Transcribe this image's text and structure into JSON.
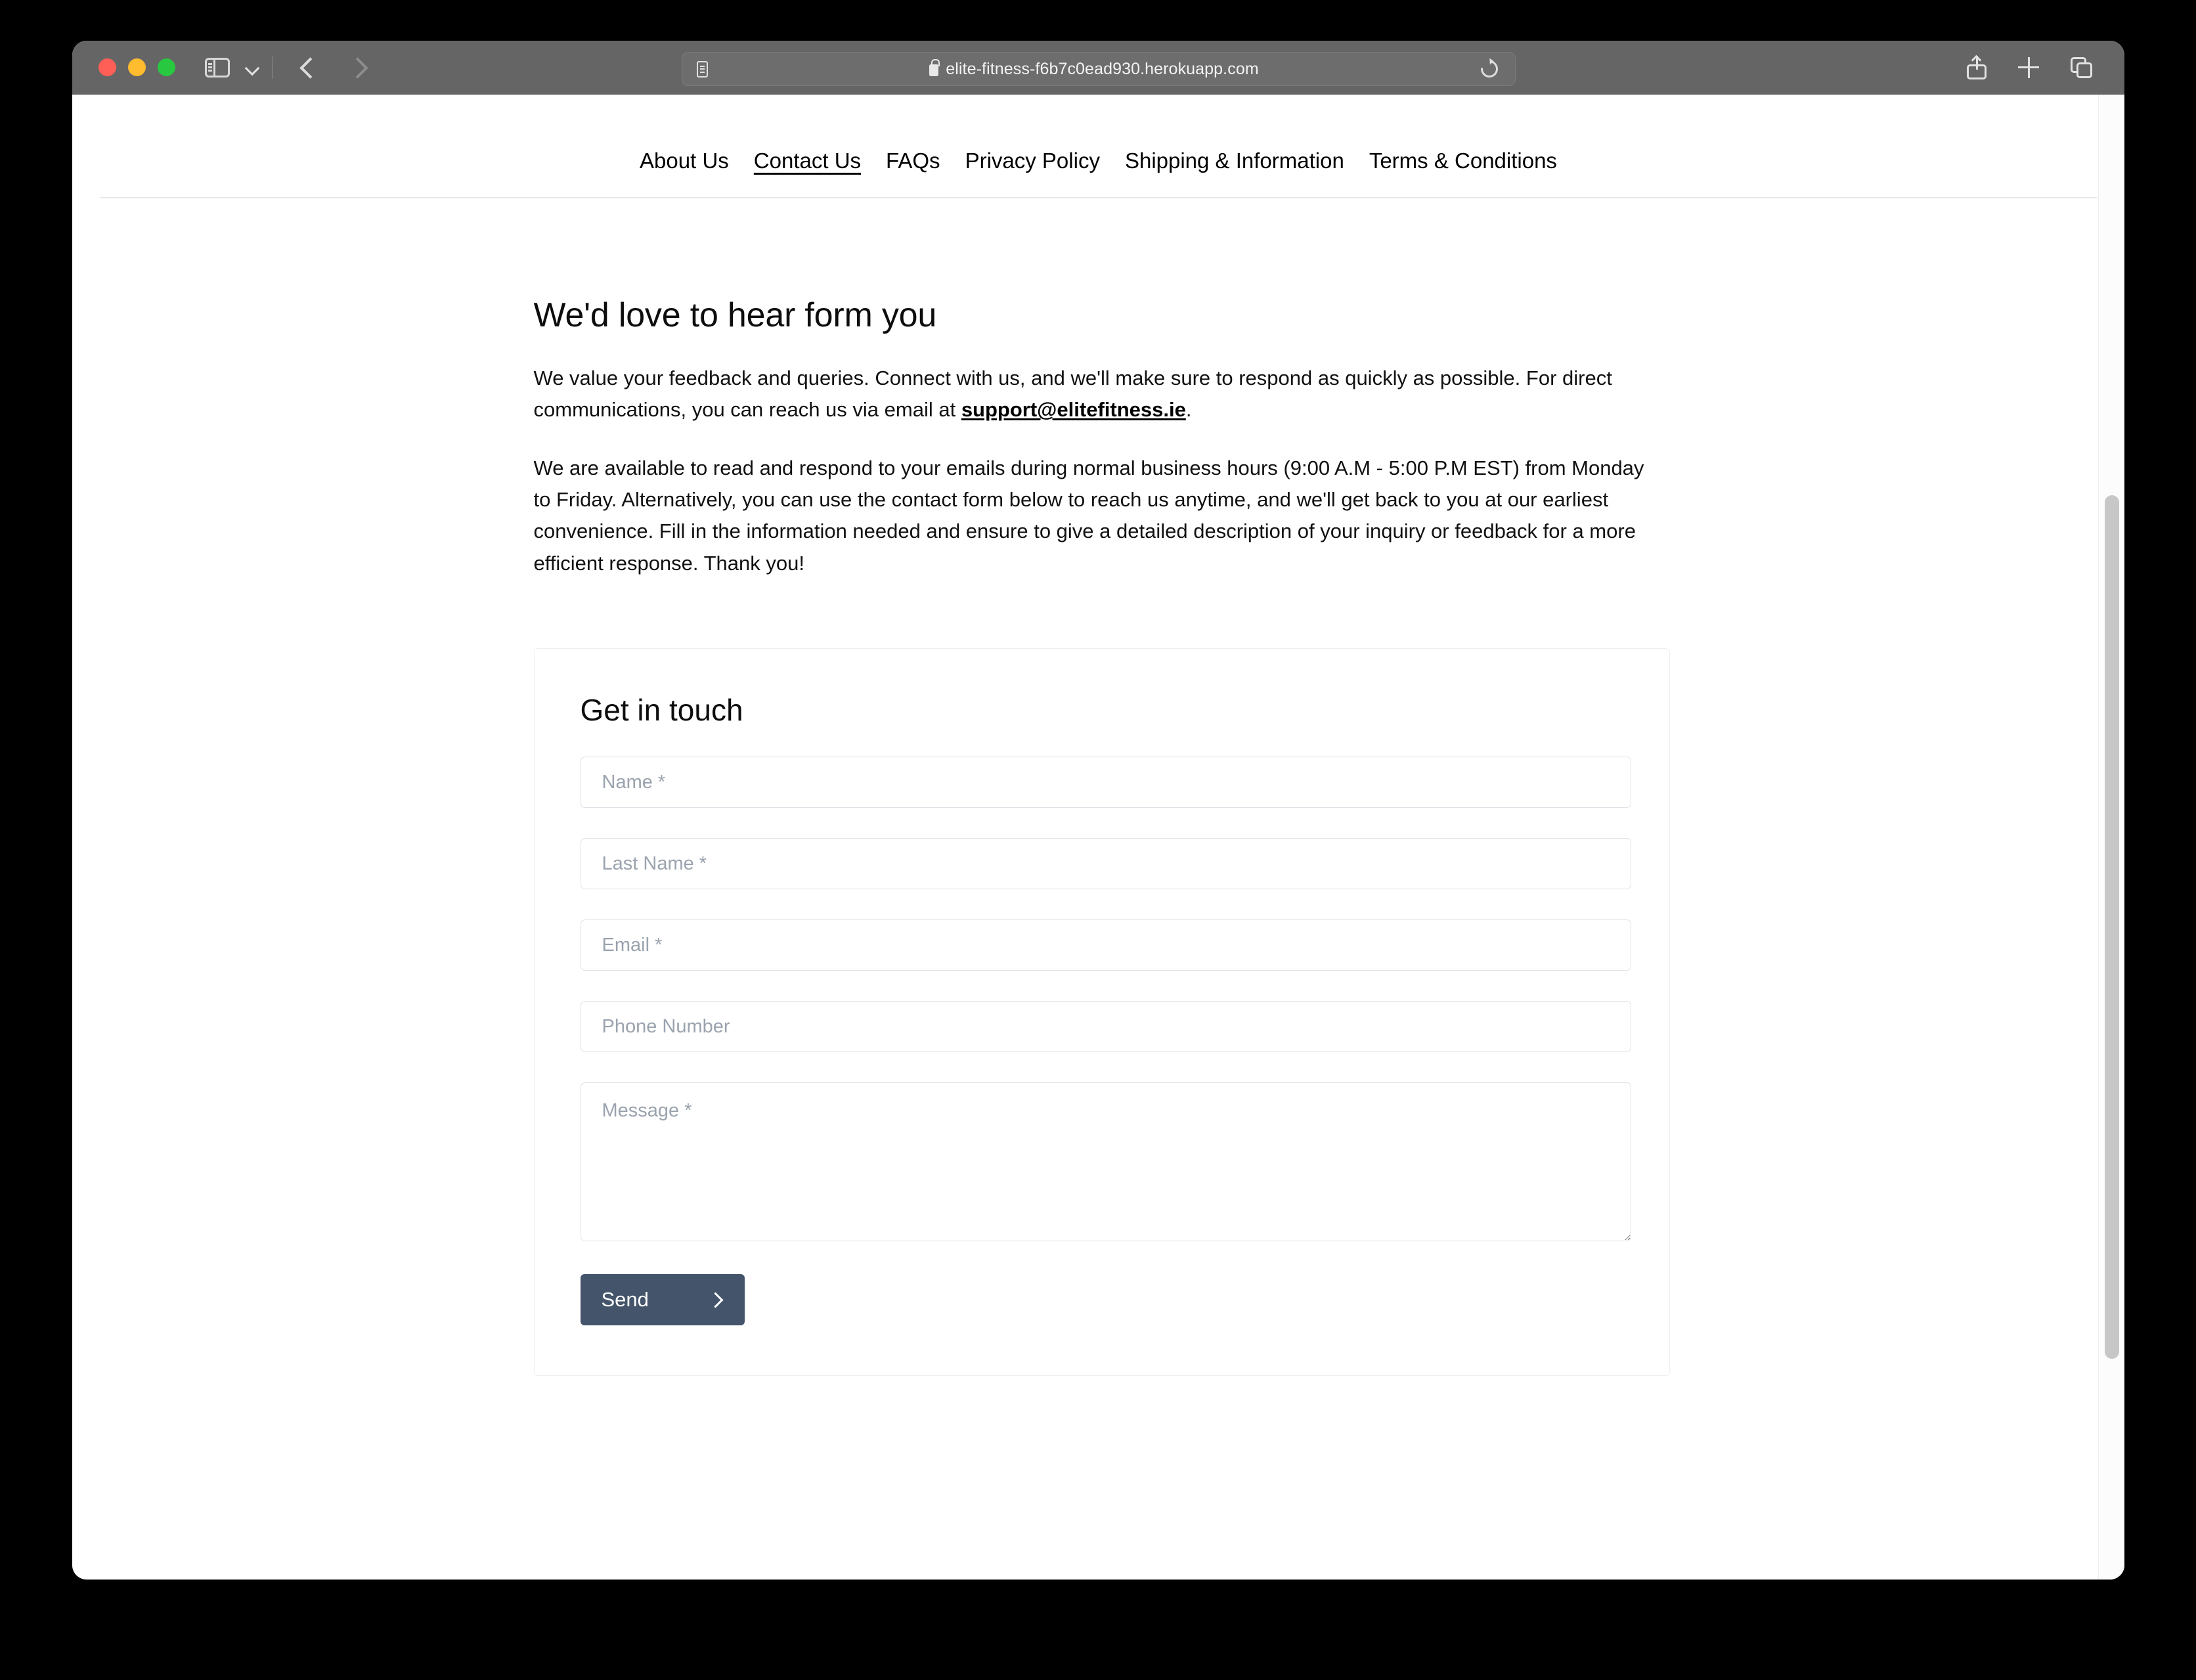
{
  "browser": {
    "url": "elite-fitness-f6b7c0ead930.herokuapp.com",
    "secure": true,
    "icons": {
      "sidebar": "sidebar-toggle-icon",
      "chevron_down": "chevron-down-icon",
      "back": "back-arrow-icon",
      "forward": "forward-arrow-icon",
      "reader": "reader-view-icon",
      "lock": "lock-icon",
      "reload": "reload-icon",
      "share": "share-icon",
      "new_tab": "plus-icon",
      "tab_overview": "tab-overview-icon"
    },
    "traffic_lights": {
      "close": "#ff5f57",
      "minimize": "#febc2e",
      "zoom": "#28c840"
    }
  },
  "site": {
    "nav": [
      {
        "label": "About Us",
        "active": false
      },
      {
        "label": "Contact Us",
        "active": true
      },
      {
        "label": "FAQs",
        "active": false
      },
      {
        "label": "Privacy Policy",
        "active": false
      },
      {
        "label": "Shipping & Information",
        "active": false
      },
      {
        "label": "Terms & Conditions",
        "active": false
      }
    ]
  },
  "main": {
    "title": "We'd love to hear form you",
    "paragraph1_before_link": "We value your feedback and queries. Connect with us, and we'll make sure to respond as quickly as possible. For direct communications, you can reach us via email at ",
    "email_link": "support@elitefitness.ie",
    "paragraph1_after_link": ".",
    "paragraph2": "We are available to read and respond to your emails during normal business hours (9:00 A.M - 5:00 P.M EST) from Monday to Friday. Alternatively, you can use the contact form below to reach us anytime, and we'll get back to you at our earliest convenience. Fill in the information needed and ensure to give a detailed description of your inquiry or feedback for a more efficient response. Thank you!"
  },
  "form": {
    "title": "Get in touch",
    "fields": [
      {
        "name": "first-name",
        "placeholder": "Name *",
        "value": "",
        "type": "text"
      },
      {
        "name": "last-name",
        "placeholder": "Last Name *",
        "value": "",
        "type": "text"
      },
      {
        "name": "email",
        "placeholder": "Email *",
        "value": "",
        "type": "email"
      },
      {
        "name": "phone",
        "placeholder": "Phone Number",
        "value": "",
        "type": "tel"
      },
      {
        "name": "message",
        "placeholder": "Message *",
        "value": "",
        "type": "textarea"
      }
    ],
    "submit_label": "Send",
    "submit_color": "#44556b"
  }
}
